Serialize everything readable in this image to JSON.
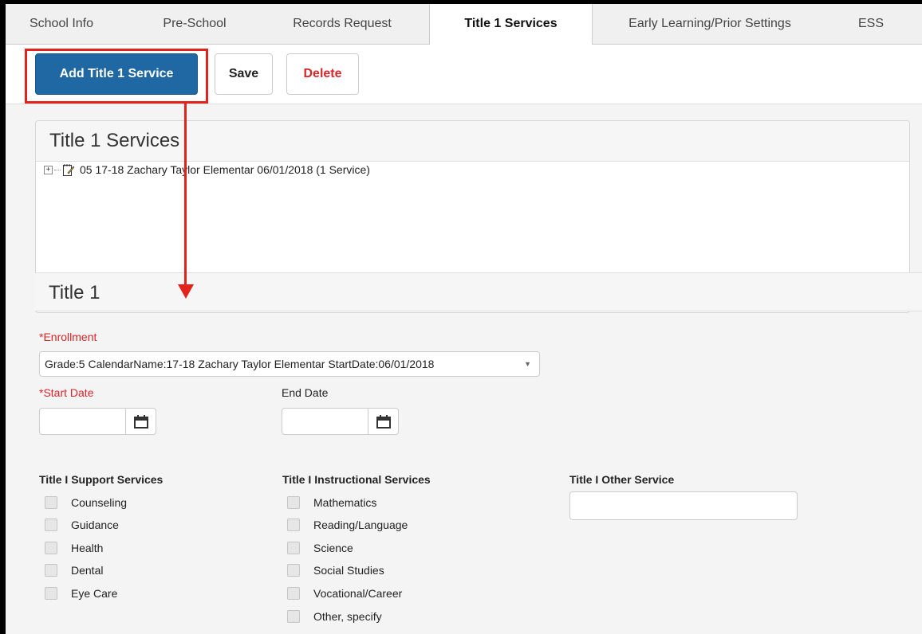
{
  "tabs": [
    "School Info",
    "Pre-School",
    "Records Request",
    "Title 1 Services",
    "Early Learning/Prior Settings",
    "ESS"
  ],
  "toolbar": {
    "add_label": "Add Title 1 Service",
    "save_label": "Save",
    "delete_label": "Delete"
  },
  "services_panel": {
    "title": "Title 1 Services",
    "tree_item": "05 17-18 Zachary Taylor Elementar 06/01/2018 (1 Service)"
  },
  "detail": {
    "title": "Title 1"
  },
  "form": {
    "enrollment_label": "*Enrollment",
    "enrollment_value": "Grade:5 CalendarName:17-18 Zachary Taylor Elementar StartDate:06/01/2018",
    "start_date_label": "*Start Date",
    "end_date_label": "End Date",
    "support_label": "Title I Support Services",
    "support": [
      "Counseling",
      "Guidance",
      "Health",
      "Dental",
      "Eye Care"
    ],
    "instructional_label": "Title I Instructional Services",
    "instructional": [
      "Mathematics",
      "Reading/Language",
      "Science",
      "Social Studies",
      "Vocational/Career",
      "Other, specify"
    ],
    "other_label": "Title I Other Service"
  },
  "colors": {
    "accent": "#1f68a3",
    "danger": "#d9262b",
    "highlight": "#e3221c"
  },
  "icons": {
    "tree_expand": "plus-box-icon",
    "tree_doc": "edit-document-icon",
    "calendar": "calendar-icon",
    "dropdown": "caret-down-icon"
  }
}
